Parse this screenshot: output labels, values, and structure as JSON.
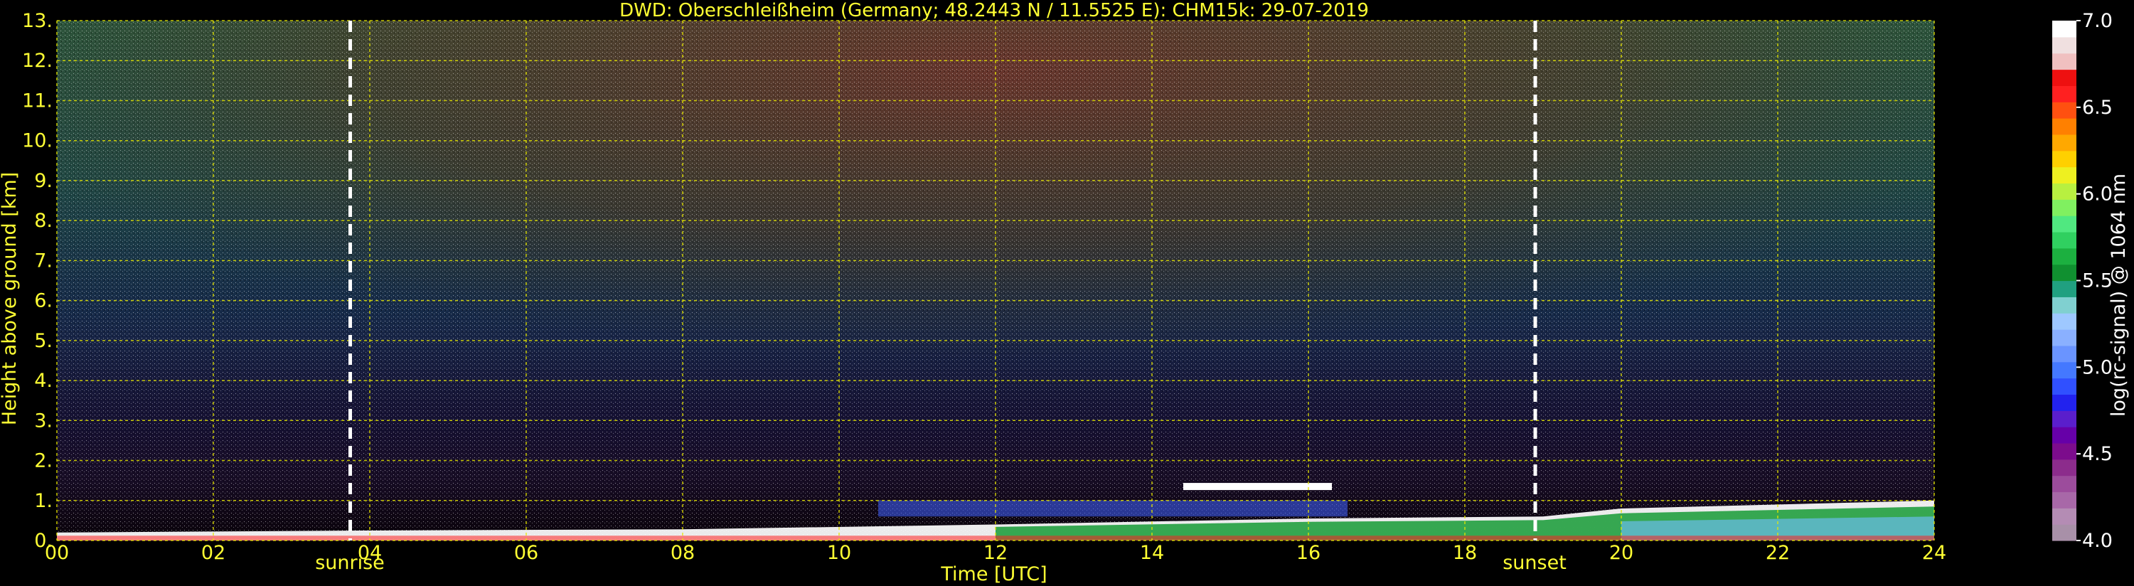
{
  "chart_data": {
    "type": "heatmap",
    "title": "DWD: Oberschleißheim (Germany; 48.2443 N / 11.5525 E):    CHM15k: 29-07-2019",
    "xlabel": "Time [UTC]",
    "ylabel": "Height above ground [km]",
    "xlim": [
      0,
      24
    ],
    "ylim": [
      0,
      13
    ],
    "x_ticks": [
      "00",
      "02",
      "04",
      "06",
      "08",
      "10",
      "12",
      "14",
      "16",
      "18",
      "20",
      "22",
      "24"
    ],
    "y_ticks": [
      "0.",
      "1.",
      "2.",
      "3.",
      "4.",
      "5.",
      "6.",
      "7.",
      "8.",
      "9.",
      "10.",
      "11.",
      "12.",
      "13."
    ],
    "grid": true,
    "annotations": [
      {
        "text": "sunrise",
        "x": 3.75
      },
      {
        "text": "sunset",
        "x": 18.9
      }
    ],
    "colorbar": {
      "label": "log(rc-signal) @ 1064 nm",
      "min": 4.0,
      "max": 7.0,
      "ticks": [
        "4.0",
        "4.5",
        "5.0",
        "5.5",
        "6.0",
        "6.5",
        "7.0"
      ],
      "colors": [
        "#a890a8",
        "#b48cb4",
        "#a868a8",
        "#9c4c9c",
        "#8c2c8c",
        "#7c0c8c",
        "#6600a8",
        "#5a1ecc",
        "#2222ee",
        "#3050ff",
        "#4478ff",
        "#6a94ff",
        "#8ab0ff",
        "#9ec8ff",
        "#80d0d0",
        "#20a080",
        "#109030",
        "#1cb040",
        "#30d060",
        "#50e880",
        "#80f060",
        "#b8f040",
        "#eef020",
        "#ffd000",
        "#ffa800",
        "#ff8000",
        "#ff5010",
        "#ff2020",
        "#ee1010",
        "#f0c0c0",
        "#f0e0e0",
        "#ffffff"
      ]
    },
    "features": [
      {
        "name": "cloud",
        "x_range": [
          14.4,
          16.3
        ],
        "height_km": 1.35
      },
      {
        "name": "aerosol_top",
        "points": [
          [
            0,
            0.2
          ],
          [
            4,
            0.25
          ],
          [
            8,
            0.28
          ],
          [
            12,
            0.4
          ],
          [
            16,
            0.55
          ],
          [
            19,
            0.6
          ],
          [
            20,
            0.8
          ],
          [
            24,
            1.0
          ]
        ]
      }
    ]
  }
}
